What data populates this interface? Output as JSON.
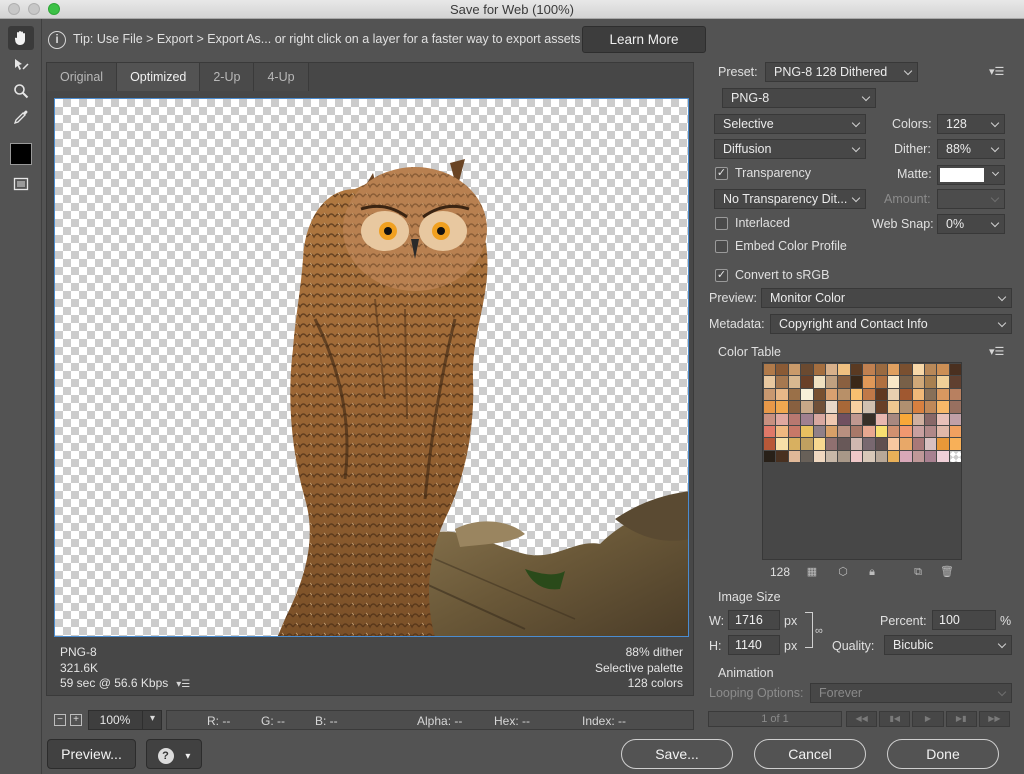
{
  "window": {
    "title": "Save for Web (100%)"
  },
  "tip": {
    "text": "Tip: Use File > Export > Export As... or right click on a layer for a faster way to export assets",
    "learn_more": "Learn More"
  },
  "tabs": [
    "Original",
    "Optimized",
    "2-Up",
    "4-Up"
  ],
  "active_tab": "Optimized",
  "view_info": {
    "format": "PNG-8",
    "size": "321.6K",
    "time": "59 sec @ 56.6 Kbps",
    "dither": "88% dither",
    "palette": "Selective palette",
    "colors": "128 colors"
  },
  "status": {
    "zoom": "100%",
    "r": "R: --",
    "g": "G: --",
    "b": "B: --",
    "alpha": "Alpha: --",
    "hex": "Hex: --",
    "index": "Index: --"
  },
  "bottom": {
    "preview": "Preview...",
    "save": "Save...",
    "cancel": "Cancel",
    "done": "Done"
  },
  "settings": {
    "preset_label": "Preset:",
    "preset": "PNG-8 128 Dithered",
    "format": "PNG-8",
    "reduction": "Selective",
    "colors_label": "Colors:",
    "colors": "128",
    "dither_algo": "Diffusion",
    "dither_label": "Dither:",
    "dither": "88%",
    "transparency": "Transparency",
    "matte_label": "Matte:",
    "matte_color": "#ffffff",
    "transparency_dither": "No Transparency Dit...",
    "amount_label": "Amount:",
    "interlaced": "Interlaced",
    "websnap_label": "Web Snap:",
    "websnap": "0%",
    "embed_profile": "Embed Color Profile",
    "convert_srgb": "Convert to sRGB",
    "preview_label": "Preview:",
    "preview": "Monitor Color",
    "metadata_label": "Metadata:",
    "metadata": "Copyright and Contact Info"
  },
  "color_table": {
    "title": "Color Table",
    "count": "128",
    "colors": [
      "#b07a4a",
      "#8a5a35",
      "#c99a6a",
      "#6b4a30",
      "#a46e3f",
      "#d8b08a",
      "#f0c080",
      "#5a3a22",
      "#c08050",
      "#9a6a40",
      "#e0a060",
      "#7a5030",
      "#f8d8a8",
      "#b88858",
      "#cc8f55",
      "#4a3020",
      "#e8c8a0",
      "#a67850",
      "#d8b890",
      "#6a4028",
      "#f0e0c0",
      "#c0a080",
      "#8a6040",
      "#3a2818",
      "#e09858",
      "#b07040",
      "#f8e8c8",
      "#786048",
      "#d0a878",
      "#a88050",
      "#f0d098",
      "#604030",
      "#c89870",
      "#e8b888",
      "#9a7048",
      "#f8f0d8",
      "#785030",
      "#d8a070",
      "#b89068",
      "#f8c070",
      "#c07848",
      "#603820",
      "#e8d0b0",
      "#a05830",
      "#f0b878",
      "#887058",
      "#d89860",
      "#b88060",
      "#e89848",
      "#f0a850",
      "#886040",
      "#c8a888",
      "#705038",
      "#e8d8c8",
      "#a86838",
      "#f8d0a0",
      "#d0c0b0",
      "#684028",
      "#f0c890",
      "#b09070",
      "#d88040",
      "#c08858",
      "#f8b868",
      "#987060",
      "#c89080",
      "#e0a8a0",
      "#b87870",
      "#a08090",
      "#d8a8a0",
      "#f0c8b0",
      "#705060",
      "#c09890",
      "#383028",
      "#e8b8b0",
      "#a88880",
      "#f8a838",
      "#d0b0a0",
      "#886868",
      "#e8c0b8",
      "#c0a0a8",
      "#e07868",
      "#f0b880",
      "#c87868",
      "#e8c060",
      "#908088",
      "#d8a068",
      "#b89080",
      "#a87868",
      "#e8a890",
      "#f8e070",
      "#d09070",
      "#f09870",
      "#c8a0a0",
      "#b08888",
      "#e0b8a8",
      "#f0a060",
      "#b85838",
      "#f8e0a8",
      "#d8b060",
      "#c0a060",
      "#f8d890",
      "#907070",
      "#685858",
      "#d0b8b0",
      "#786870",
      "#605050",
      "#f8c8a0",
      "#e8a868",
      "#a87878",
      "#d8c0c0",
      "#e89838",
      "#f8b058",
      "#282018",
      "#483020",
      "#e0b898",
      "#686058",
      "#f0d8c0",
      "#c8b8a8",
      "#a89888",
      "#f0c8c8",
      "#d8c8b8",
      "#b8a898",
      "#e8b058",
      "#d8a8b8",
      "#c09898",
      "#a88090",
      "#f0d0d8",
      "checker"
    ]
  },
  "image_size": {
    "title": "Image Size",
    "w_label": "W:",
    "w": "1716",
    "h_label": "H:",
    "h": "1140",
    "unit": "px",
    "percent_label": "Percent:",
    "percent": "100",
    "percent_unit": "%",
    "quality_label": "Quality:",
    "quality": "Bicubic"
  },
  "animation": {
    "title": "Animation",
    "looping_label": "Looping Options:",
    "looping": "Forever",
    "frame": "1 of 1"
  }
}
